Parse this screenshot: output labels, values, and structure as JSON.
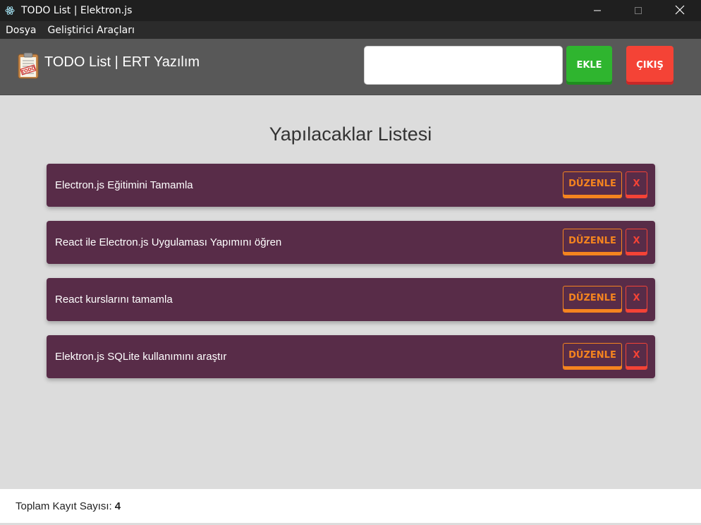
{
  "window": {
    "title": "TODO List | Elektron.js",
    "app_icon": "electron-atom-icon",
    "controls": [
      "minimize-icon",
      "maximize-icon",
      "close-icon"
    ]
  },
  "menubar": {
    "items": [
      {
        "label": "Dosya"
      },
      {
        "label": "Geliştirici Araçları"
      }
    ]
  },
  "header": {
    "logo_icon": "todo-clipboard-icon",
    "logo_text": "TODO",
    "brand": "TODO List | ERT Yazılım",
    "input_value": "",
    "add_label": "EKLE",
    "exit_label": "ÇIKIŞ"
  },
  "main": {
    "title": "Yapılacaklar Listesi",
    "edit_label": "DÜZENLE",
    "delete_label": "X",
    "todos": [
      {
        "text": "Electron.js Eğitimini Tamamla"
      },
      {
        "text": "React ile Electron.js Uygulaması Yapımını öğren"
      },
      {
        "text": "React kurslarını tamamla"
      },
      {
        "text": "Elektron.js SQLite kullanımını araştır"
      }
    ]
  },
  "footer": {
    "label": "Toplam Kayıt Sayısı:",
    "count": "4"
  },
  "colors": {
    "header_bg": "#585858",
    "todo_bg": "#582c48",
    "add_green": "#2fb52f",
    "exit_red": "#f44336",
    "edit_orange": "#f5841f",
    "page_bg": "#dcdcdc"
  }
}
